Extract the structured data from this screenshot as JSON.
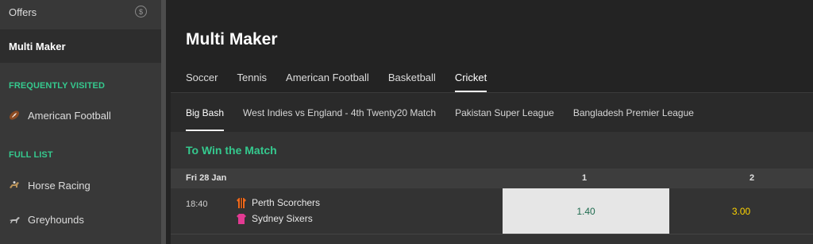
{
  "sidebar": {
    "offers_label": "Offers",
    "offers_icon": "$",
    "multi_maker_label": "Multi Maker",
    "frequently_visited_label": "FREQUENTLY VISITED",
    "full_list_label": "FULL LIST",
    "items": [
      {
        "label": "American Football",
        "icon": "american-football-icon"
      },
      {
        "label": "Horse Racing",
        "icon": "horse-racing-icon"
      },
      {
        "label": "Greyhounds",
        "icon": "greyhound-icon"
      }
    ]
  },
  "header": {
    "title": "Multi Maker",
    "sport_tabs": [
      "Soccer",
      "Tennis",
      "American Football",
      "Basketball",
      "Cricket"
    ],
    "active_sport": "Cricket"
  },
  "competitions": {
    "tabs": [
      "Big Bash",
      "West Indies vs England - 4th Twenty20 Match",
      "Pakistan Super League",
      "Bangladesh Premier League"
    ],
    "active": "Big Bash"
  },
  "market": {
    "title": "To Win the Match",
    "date": "Fri 28 Jan",
    "col1": "1",
    "col2": "2",
    "events": [
      {
        "time": "18:40",
        "team1": "Perth Scorchers",
        "team2": "Sydney Sixers",
        "odds1": "1.40",
        "odds2": "3.00"
      }
    ]
  },
  "colors": {
    "accent_green": "#35c98e",
    "odds_yellow": "#ffd400",
    "selected_odds_bg": "#e6e6e6"
  }
}
